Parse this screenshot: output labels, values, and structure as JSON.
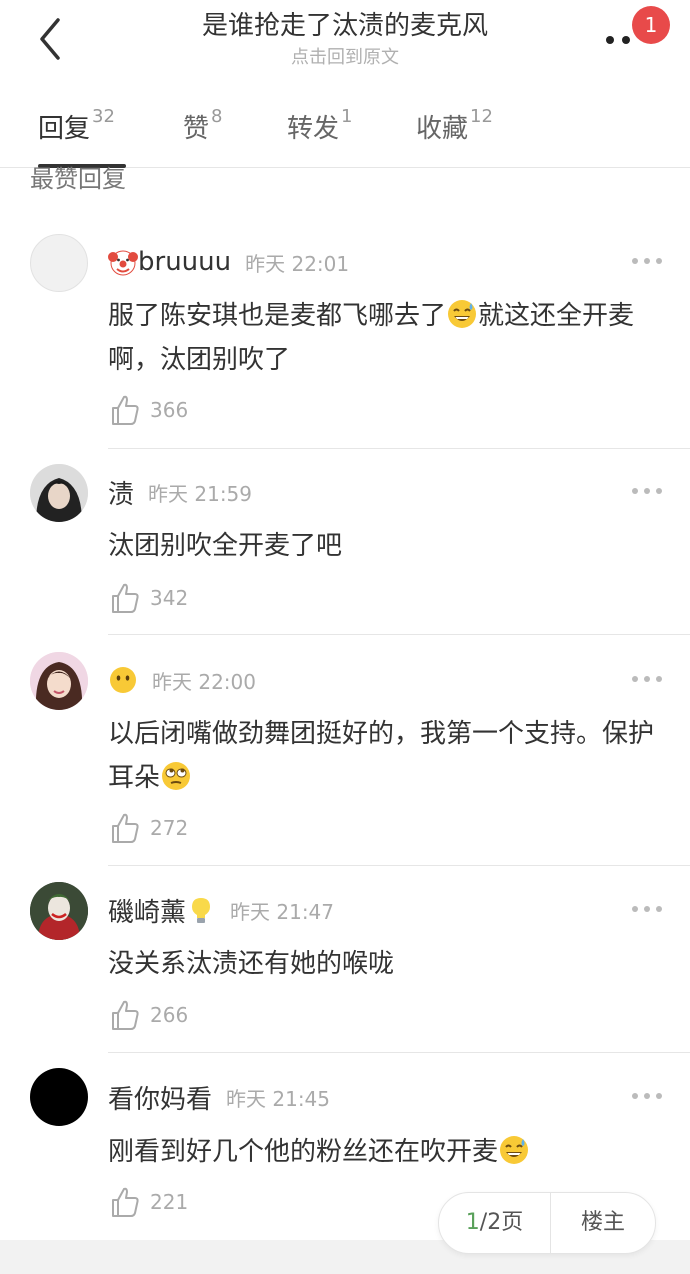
{
  "header": {
    "title": "是谁抢走了汰渍的麦克风",
    "subtitle": "点击回到原文",
    "badge": "1"
  },
  "tabs": [
    {
      "label": "回复",
      "count": "32"
    },
    {
      "label": "赞",
      "count": "8"
    },
    {
      "label": "转发",
      "count": "1"
    },
    {
      "label": "收藏",
      "count": "12"
    }
  ],
  "section_title": "最赞回复",
  "comments": [
    {
      "username": "bruuuu",
      "time": "昨天 22:01",
      "text_a": "服了陈安琪也是麦都飞哪去了",
      "text_b": "就这还全开麦啊，汰团别吹了",
      "likes": "366",
      "avatar_icon": "blank-avatar",
      "name_icon": "clown-face-icon"
    },
    {
      "username": "渍",
      "time": "昨天 21:59",
      "text": "汰团别吹全开麦了吧",
      "likes": "342",
      "avatar_icon": "photo-avatar"
    },
    {
      "username": "",
      "time": "昨天 22:00",
      "text_a": "以后闭嘴做劲舞团挺好的，我第一个支持。保护耳朵",
      "likes": "272",
      "avatar_icon": "photo-avatar",
      "name_icon": "no-mouth-face-icon"
    },
    {
      "username": "磯崎薰",
      "time": "昨天 21:47",
      "text": "没关系汰渍还有她的喉咙",
      "likes": "266",
      "avatar_icon": "photo-avatar",
      "name_icon": "lightbulb-icon"
    },
    {
      "username": "看你妈看",
      "time": "昨天 21:45",
      "text_a": "刚看到好几个他的粉丝还在吹开麦",
      "likes": "221",
      "avatar_icon": "black-avatar"
    }
  ],
  "pager": {
    "current": "1",
    "rest": "/2页",
    "op_label": "楼主"
  },
  "colors": {
    "badge": "#e84a4a",
    "pager_current": "#59a05a",
    "text": "#333333",
    "muted": "#aaaaaa"
  }
}
